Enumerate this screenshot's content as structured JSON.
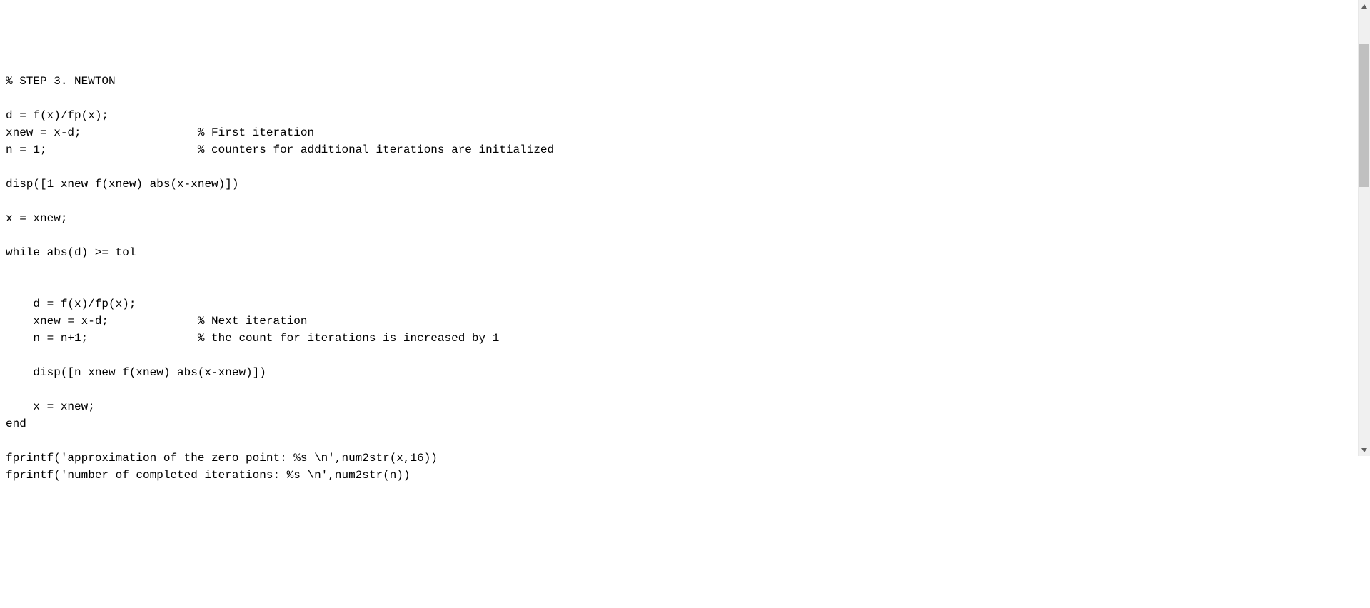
{
  "code": {
    "lines": [
      "% STEP 3. NEWTON",
      "",
      "d = f(x)/fp(x);",
      "xnew = x-d;                 % First iteration",
      "n = 1;                      % counters for additional iterations are initialized",
      "",
      "disp([1 xnew f(xnew) abs(x-xnew)])",
      "",
      "x = xnew;",
      "",
      "while abs(d) >= tol",
      "",
      "",
      "    d = f(x)/fp(x);",
      "    xnew = x-d;             % Next iteration",
      "    n = n+1;                % the count for iterations is increased by 1",
      "    ",
      "    disp([n xnew f(xnew) abs(x-xnew)])",
      "    ",
      "    x = xnew;",
      "end",
      "",
      "fprintf('approximation of the zero point: %s \\n',num2str(x,16))",
      "fprintf('number of completed iterations: %s \\n',num2str(n))"
    ]
  }
}
